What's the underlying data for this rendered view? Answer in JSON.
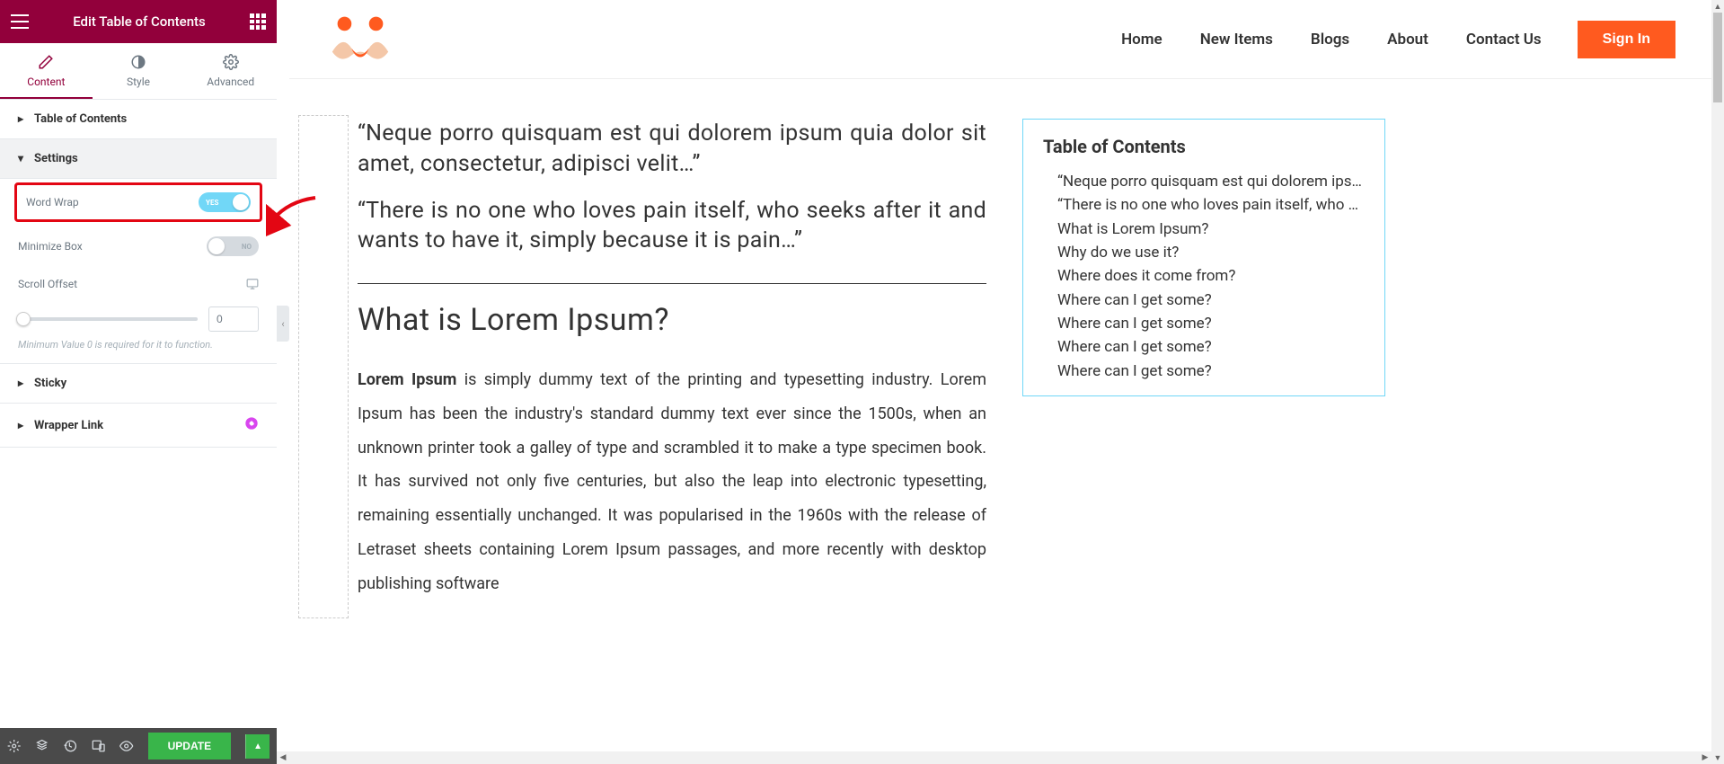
{
  "sidebar": {
    "title": "Edit Table of Contents",
    "tabs": {
      "content": "Content",
      "style": "Style",
      "advanced": "Advanced"
    },
    "sections": {
      "toc": "Table of Contents",
      "settings": "Settings",
      "sticky": "Sticky",
      "wrapper": "Wrapper Link"
    },
    "controls": {
      "word_wrap": {
        "label": "Word Wrap",
        "value": "YES"
      },
      "minimize_box": {
        "label": "Minimize Box",
        "value": "NO"
      },
      "scroll_offset": {
        "label": "Scroll Offset",
        "value": "0"
      },
      "hint": "Minimum Value 0 is required for it to function."
    },
    "footer": {
      "update": "Update"
    }
  },
  "nav": {
    "items": [
      "Home",
      "New Items",
      "Blogs",
      "About",
      "Contact Us"
    ],
    "signin": "Sign In"
  },
  "article": {
    "quote1": "“Neque porro quisquam est qui dolorem ipsum quia dolor sit amet, consectetur, adipisci velit…”",
    "quote2": "“There is no one who loves pain itself, who seeks after it and wants to have it, simply because it is pain…”",
    "h2": "What is Lorem Ipsum?",
    "p_strong": "Lorem Ipsum",
    "p_rest": " is simply dummy text of the printing and typesetting industry. Lorem Ipsum has been the industry's standard dummy text ever since the 1500s, when an unknown printer took a galley of type and scrambled it to make a type specimen book. It has survived not only five centuries, but also the leap into electronic typesetting, remaining essentially unchanged. It was popularised in the 1960s with the release of Letraset sheets containing Lorem Ipsum passages, and more recently with desktop publishing software"
  },
  "toc": {
    "title": "Table of Contents",
    "items": [
      "“Neque porro quisquam est qui dolorem ipsu…",
      "“There is no one who loves pain itself, who see…",
      "What is Lorem Ipsum?",
      "Why do we use it?",
      "Where does it come from?",
      "Where can I get some?",
      "Where can I get some?",
      "Where can I get some?",
      "Where can I get some?"
    ]
  }
}
